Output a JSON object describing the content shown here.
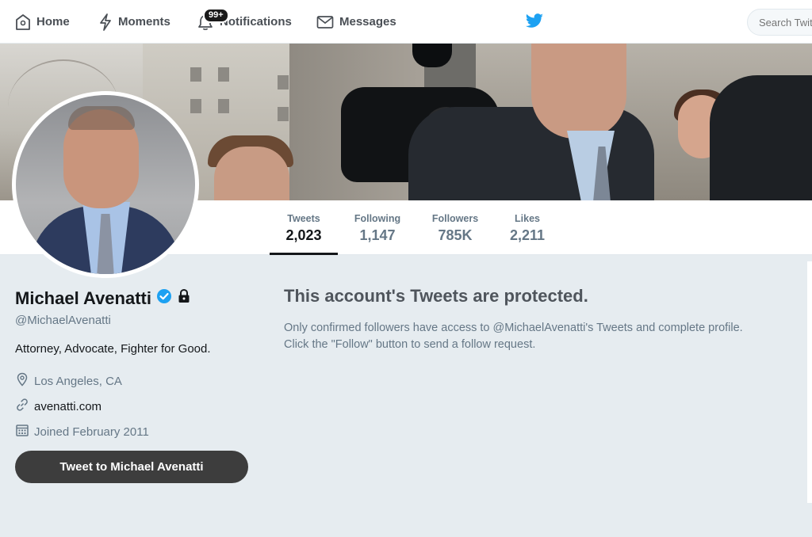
{
  "nav": {
    "home": "Home",
    "moments": "Moments",
    "notifications": "Notifications",
    "notifications_badge": "99+",
    "messages": "Messages",
    "search_placeholder": "Search Twit"
  },
  "profile_nav": {
    "stats": [
      {
        "label": "Tweets",
        "value": "2,023"
      },
      {
        "label": "Following",
        "value": "1,147"
      },
      {
        "label": "Followers",
        "value": "785K"
      },
      {
        "label": "Likes",
        "value": "2,211"
      }
    ]
  },
  "profile": {
    "name": "Michael Avenatti",
    "handle": "@MichaelAvenatti",
    "bio": "Attorney, Advocate, Fighter for Good.",
    "location": "Los Angeles, CA",
    "url": "avenatti.com",
    "joined": "Joined February 2011",
    "tweet_to_button": "Tweet to Michael Avenatti"
  },
  "protected": {
    "title": "This account's Tweets are protected.",
    "line1": "Only confirmed followers have access to @MichaelAvenatti's Tweets and complete profile.",
    "line2": "Click the \"Follow\" button to send a follow request."
  },
  "colors": {
    "twitter_blue": "#1da1f2",
    "verified_badge": "#1da1f2",
    "page_bg": "#e6ecf0",
    "button_dark": "#3d3d3d"
  },
  "icons": [
    "home-icon",
    "moments-icon",
    "notifications-icon",
    "messages-icon",
    "twitter-bird-icon",
    "verified-icon",
    "lock-icon",
    "location-icon",
    "link-icon",
    "calendar-icon"
  ]
}
